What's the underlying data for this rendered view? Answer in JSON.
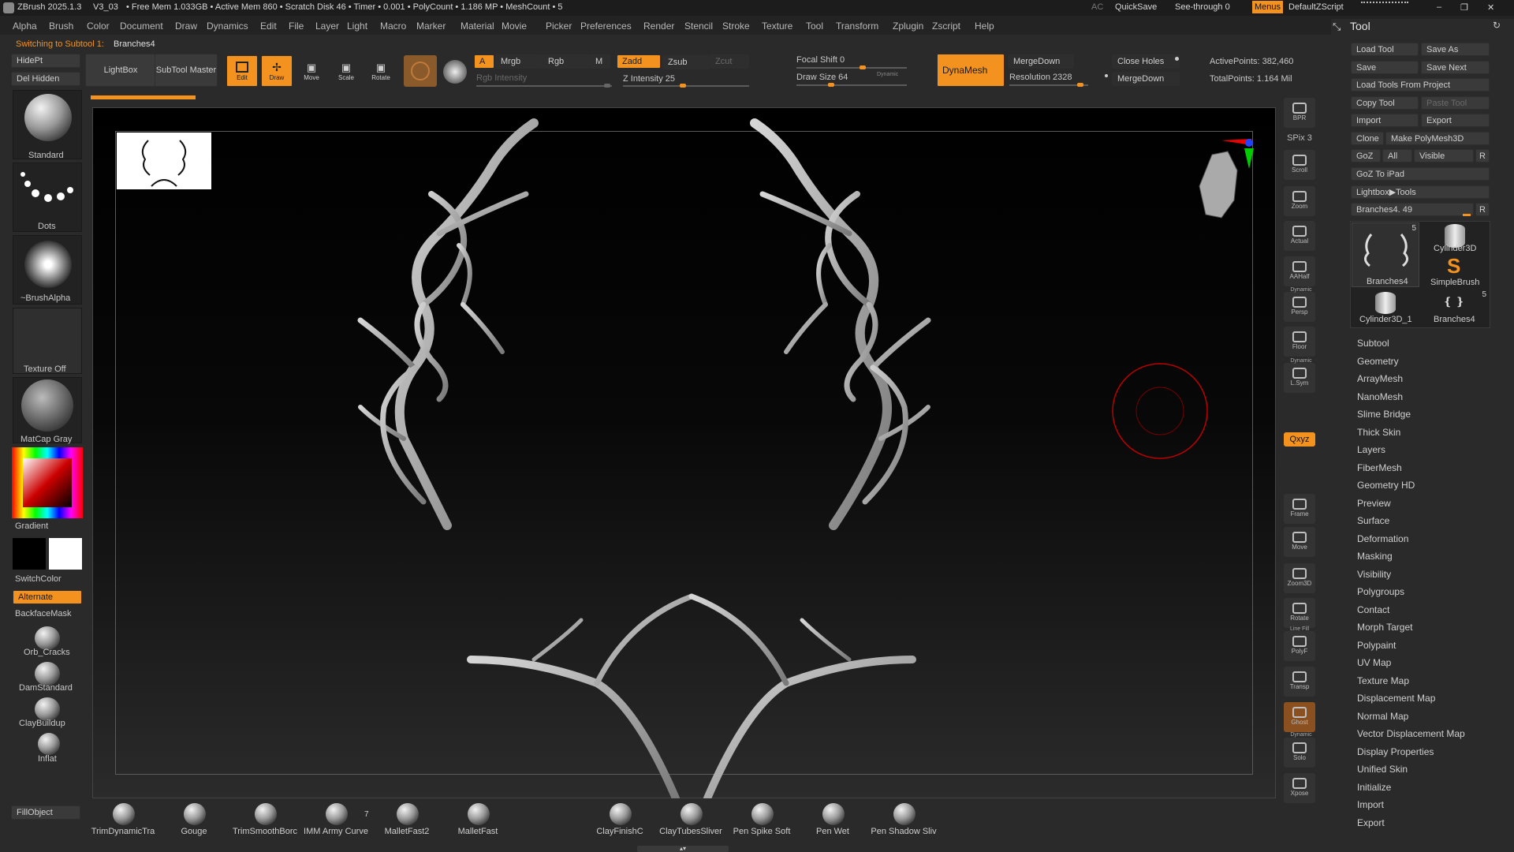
{
  "titlebar": {
    "app": "ZBrush 2025.1.3",
    "version": "V3_03",
    "stats": "• Free Mem 1.033GB • Active Mem 860 • Scratch Disk 46 • Timer • 0.001 • PolyCount • 1.186 MP • MeshCount • 5",
    "ac": "AC",
    "quicksave": "QuickSave",
    "seethrough": "See-through  0",
    "menus": "Menus",
    "script": "DefaultZScript"
  },
  "menus": [
    "Alpha",
    "Brush",
    "Color",
    "Document",
    "Draw",
    "Dynamics",
    "Edit",
    "File",
    "Layer",
    "Light",
    "Macro",
    "Marker",
    "Material",
    "Movie",
    "Picker",
    "Preferences",
    "Render",
    "Stencil",
    "Stroke",
    "Texture",
    "Tool",
    "Transform",
    "Zplugin",
    "Zscript",
    "Help"
  ],
  "status": {
    "prefix": "Switching to Subtool 1:",
    "name": "Branches4"
  },
  "top": {
    "hidept": "HidePt",
    "delhidden": "Del Hidden",
    "lightbox": "LightBox",
    "subtool_master": "SubTool Master",
    "edit": "Edit",
    "draw": "Draw",
    "move": "Move",
    "scale": "Scale",
    "rotate": "Rotate",
    "a": "A",
    "mrgb": "Mrgb",
    "rgb": "Rgb",
    "m": "M",
    "rgb_intensity": "Rgb Intensity",
    "zadd": "Zadd",
    "zsub": "Zsub",
    "zcut": "Zcut",
    "z_intensity": "Z Intensity 25",
    "focal_shift": "Focal Shift 0",
    "draw_size": "Draw Size 64",
    "dynamic": "Dynamic",
    "dynamesh": "DynaMesh",
    "mergedown": "MergeDown",
    "resolution": "Resolution 2328",
    "close_holes": "Close Holes",
    "mergedown2": "MergeDown",
    "active_points": "ActivePoints: 382,460",
    "total_points": "TotalPoints: 1.164 Mil"
  },
  "left": {
    "standard": "Standard",
    "dots": "Dots",
    "brushalpha": "~BrushAlpha",
    "texture_off": "Texture Off",
    "matcap": "MatCap Gray",
    "gradient": "Gradient",
    "switchcolor": "SwitchColor",
    "alternate": "Alternate",
    "backfacemask": "BackfaceMask",
    "brushes": [
      "Orb_Cracks",
      "DamStandard",
      "ClayBuildup",
      "Inflat"
    ],
    "fillobject": "FillObject"
  },
  "right_shelf": [
    "BPR",
    "SPix 3",
    "Scroll",
    "Zoom",
    "Actual",
    "AAHalf",
    "Persp",
    "Floor",
    "L.Sym",
    "",
    "Qxyz",
    "",
    "",
    "Frame",
    "Move",
    "Zoom3D",
    "Rotate",
    "PolyF",
    "Transp",
    "Ghost",
    "Solo",
    "Xpose"
  ],
  "right_shelf_labels": {
    "dynamic": "Dynamic",
    "linefill": "Line Fill"
  },
  "tool": {
    "title": "Tool",
    "load": "Load Tool",
    "saveas": "Save As",
    "save": "Save",
    "savenext": "Save Next",
    "loadproj": "Load Tools From Project",
    "copy": "Copy Tool",
    "paste": "Paste Tool",
    "import": "Import",
    "export": "Export",
    "clone": "Clone",
    "make": "Make PolyMesh3D",
    "goz": "GoZ",
    "all": "All",
    "visible": "Visible",
    "r": "R",
    "goz_ipad": "GoZ To iPad",
    "lightbox_tools": "Lightbox▶Tools",
    "slider": "Branches4. 49",
    "r2": "R",
    "thumbs": [
      {
        "name": "Branches4",
        "count": "5"
      },
      {
        "name": "Cylinder3D",
        "count": ""
      },
      {
        "name": "SimpleBrush",
        "count": ""
      },
      {
        "name": "Cylinder3D_1",
        "count": ""
      },
      {
        "name": "Branches4",
        "count": "5"
      }
    ],
    "menu": [
      "Subtool",
      "Geometry",
      "ArrayMesh",
      "NanoMesh",
      "Slime Bridge",
      "Thick Skin",
      "Layers",
      "FiberMesh",
      "Geometry HD",
      "Preview",
      "Surface",
      "Deformation",
      "Masking",
      "Visibility",
      "Polygroups",
      "Contact",
      "Morph Target",
      "Polypaint",
      "UV Map",
      "Texture Map",
      "Displacement Map",
      "Normal Map",
      "Vector Displacement Map",
      "Display Properties",
      "Unified Skin",
      "Initialize",
      "Import",
      "Export"
    ]
  },
  "bottom": {
    "brushes": [
      "TrimDynamicTra",
      "Gouge",
      "TrimSmoothBorc",
      "IMM Army Curve",
      "MalletFast2",
      "MalletFast",
      "ClayFinishC",
      "ClayTubesSliver",
      "Pen Spike Soft",
      "Pen Wet",
      "Pen Shadow Sliv"
    ],
    "imm_count": "7"
  },
  "colors": {
    "accent": "#f3921f",
    "bg": "#2a2a2a"
  }
}
